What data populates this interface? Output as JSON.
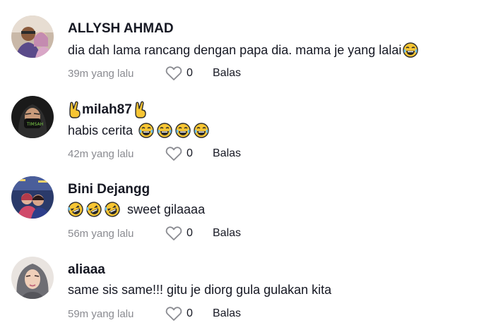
{
  "comments": [
    {
      "username": "ALLYSH AHMAD",
      "text": "dia dah lama rancang dengan papa dia. mama je yang lalai",
      "time": "39m yang lalu",
      "likes": "0",
      "reply_label": "Balas"
    },
    {
      "username": "milah87",
      "text": "habis cerita",
      "time": "42m yang lalu",
      "likes": "0",
      "reply_label": "Balas"
    },
    {
      "username": "Bini Dejangg",
      "text": "sweet gilaaaa",
      "time": "56m yang lalu",
      "likes": "0",
      "reply_label": "Balas"
    },
    {
      "username": "aliaaa",
      "text": "same sis same!!! gitu je diorg gula gulakan kita",
      "time": "59m yang lalu",
      "likes": "0",
      "reply_label": "Balas"
    }
  ],
  "icons": {
    "like": "heart-outline-icon",
    "laugh": "tears-of-joy-emoji",
    "rofl": "rolling-laughing-emoji",
    "victory": "victory-hand-emoji"
  },
  "colors": {
    "text": "#161823",
    "muted": "#8a8b91",
    "emoji_face": "#f7c533"
  }
}
